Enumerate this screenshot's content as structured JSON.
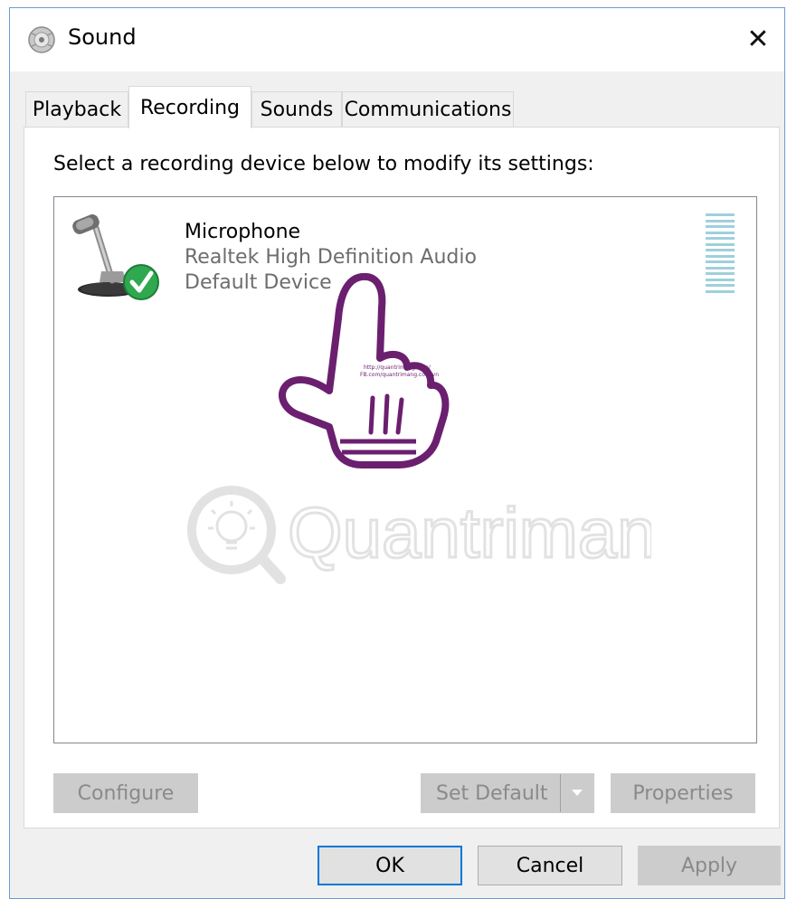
{
  "window": {
    "title": "Sound",
    "close_symbol": "✕"
  },
  "tabs": [
    {
      "label": "Playback",
      "active": false
    },
    {
      "label": "Recording",
      "active": true
    },
    {
      "label": "Sounds",
      "active": false
    },
    {
      "label": "Communications",
      "active": false
    }
  ],
  "panel": {
    "instruction": "Select a recording device below to modify its settings:",
    "devices": [
      {
        "name": "Microphone",
        "driver": "Realtek High Definition Audio",
        "status": "Default Device",
        "icon": "microphone-icon",
        "badge": "default-check-icon"
      }
    ],
    "buttons": {
      "configure": "Configure",
      "set_default": "Set Default",
      "properties": "Properties"
    }
  },
  "dialog_buttons": {
    "ok": "OK",
    "cancel": "Cancel",
    "apply": "Apply"
  },
  "watermark": {
    "brand": "Quantrimang",
    "cursor_url_1": "http://quantrimang.com/",
    "cursor_url_2": "FB.com/quantrimang.com.vn"
  },
  "colors": {
    "accent": "#0078d7",
    "check_green": "#2fa84f",
    "level_meter": "#9fd0db",
    "cursor_outline": "#6b1f6f"
  }
}
